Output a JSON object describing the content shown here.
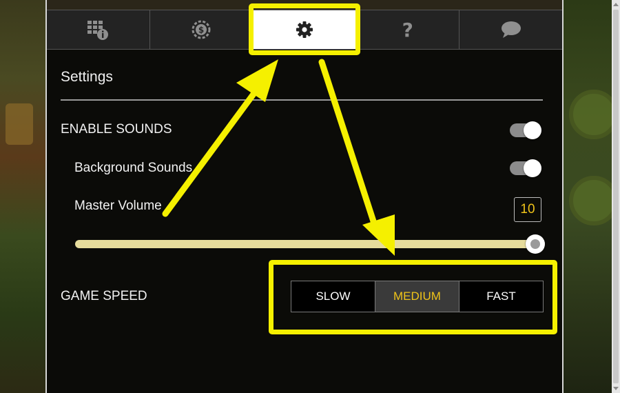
{
  "tabs": [
    {
      "icon": "paytable-grid-icon",
      "active": false
    },
    {
      "icon": "coin-bet-icon",
      "active": false
    },
    {
      "icon": "gear-icon",
      "active": true
    },
    {
      "icon": "question-icon",
      "glyph": "?",
      "active": false
    },
    {
      "icon": "chat-icon",
      "active": false
    }
  ],
  "settings": {
    "title": "Settings",
    "enable_sounds_label": "ENABLE SOUNDS",
    "enable_sounds_on": true,
    "background_sounds_label": "Background Sounds",
    "background_sounds_on": true,
    "master_volume_label": "Master Volume",
    "master_volume_value": "10",
    "master_volume_level": 1.0,
    "game_speed_label": "GAME SPEED",
    "game_speed_options": [
      "SLOW",
      "MEDIUM",
      "FAST"
    ],
    "game_speed_selected": "MEDIUM"
  },
  "colors": {
    "accent_yellow": "#f0c419",
    "annotation_yellow": "#f5f000",
    "panel_bg": "#0b0b08"
  }
}
